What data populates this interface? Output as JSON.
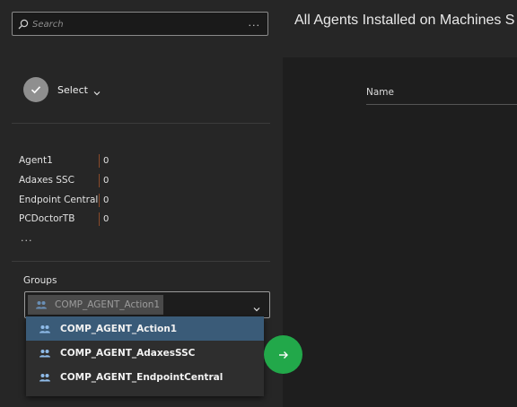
{
  "search": {
    "placeholder": "Search",
    "more": "..."
  },
  "page": {
    "title": "All Agents Installed on Machines S"
  },
  "select": {
    "label": "Select"
  },
  "agents": [
    {
      "name": "Agent1",
      "count": "0"
    },
    {
      "name": "Adaxes SSC",
      "count": "0"
    },
    {
      "name": "Endpoint Central",
      "count": "0"
    },
    {
      "name": "PCDoctorTB",
      "count": "0"
    }
  ],
  "agents_more": "...",
  "groups": {
    "label": "Groups",
    "selected": "COMP_AGENT_Action1",
    "options": [
      {
        "label": "COMP_AGENT_Action1",
        "selected": true
      },
      {
        "label": "COMP_AGENT_AdaxesSSC",
        "selected": false
      },
      {
        "label": "COMP_AGENT_EndpointCentral",
        "selected": false
      }
    ]
  },
  "table": {
    "columns": [
      "Name"
    ]
  },
  "colors": {
    "accent_green": "#22a84a",
    "selection_blue": "#3a5b78",
    "agent_separator": "#8a4a2a"
  },
  "icons": {
    "search": "search-icon",
    "check": "check-icon",
    "chevron": "chevron-down-icon",
    "group": "group-icon",
    "go": "arrow-right-icon"
  }
}
